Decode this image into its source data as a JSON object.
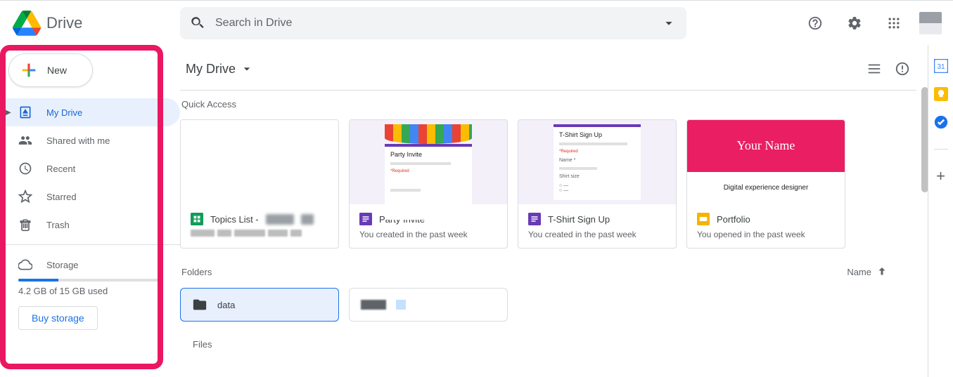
{
  "brand": {
    "name": "Drive"
  },
  "search": {
    "placeholder": "Search in Drive"
  },
  "new_button": {
    "label": "New"
  },
  "nav": {
    "my_drive": "My Drive",
    "shared": "Shared with me",
    "recent": "Recent",
    "starred": "Starred",
    "trash": "Trash",
    "storage": "Storage"
  },
  "storage": {
    "text": "4.2 GB of 15 GB used",
    "buy": "Buy storage"
  },
  "path": {
    "current": "My Drive"
  },
  "sections": {
    "quick_access": "Quick Access",
    "folders": "Folders",
    "files": "Files"
  },
  "cards": [
    {
      "title": "Topics List - ",
      "subtitle": ""
    },
    {
      "title": "Party Invite",
      "subtitle": "You created in the past week"
    },
    {
      "title": "T-Shirt Sign Up",
      "subtitle": "You created in the past week"
    },
    {
      "title": "Portfolio",
      "subtitle": "You opened in the past week"
    }
  ],
  "portfolio_preview": {
    "name": "Your Name",
    "tagline": "Digital experience designer"
  },
  "form_preview": {
    "party_title": "Party Invite",
    "tshirt_title": "T-Shirt Sign Up",
    "required": "*Required",
    "name_label": "Name *",
    "size_label": "Shirt size"
  },
  "sort": {
    "label": "Name"
  },
  "folders": [
    {
      "name": "data",
      "selected": true
    },
    {
      "name": "",
      "selected": false
    }
  ]
}
